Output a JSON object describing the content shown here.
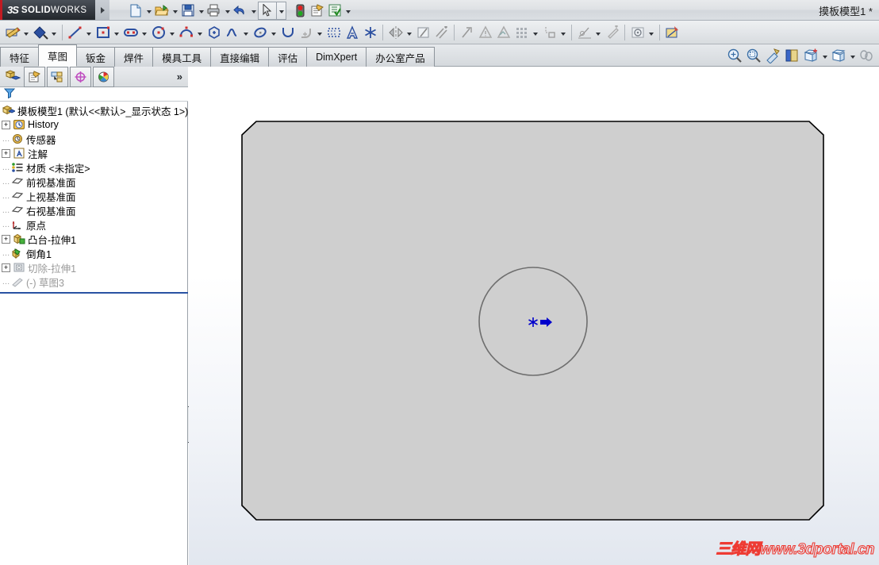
{
  "app": {
    "brand_ds": "3S",
    "brand_name_bold": "SOLID",
    "brand_name_light": "WORKS",
    "document_title": "摸板模型1 *"
  },
  "standard_toolbar": {
    "items": [
      {
        "name": "new-document-button",
        "icon": "new-doc-icon",
        "caret": true
      },
      {
        "name": "open-document-button",
        "icon": "open-folder-icon",
        "caret": true
      },
      {
        "name": "save-button",
        "icon": "save-disk-icon",
        "caret": true
      },
      {
        "name": "print-button",
        "icon": "printer-icon",
        "caret": true
      },
      {
        "name": "undo-button",
        "icon": "undo-arrow-icon",
        "caret": true
      },
      {
        "name": "select-button",
        "icon": "cursor-arrow-icon",
        "caret": true,
        "selected": true
      },
      {
        "name": "rebuild-button",
        "icon": "traffic-light-icon",
        "caret": false
      },
      {
        "name": "file-properties-button",
        "icon": "document-properties-icon",
        "caret": false
      },
      {
        "name": "options-button",
        "icon": "options-checklist-icon",
        "caret": true
      }
    ]
  },
  "sketch_toolbar": {
    "items": [
      {
        "name": "sketch-button",
        "icon": "sketch-pencil-icon",
        "caret": true
      },
      {
        "name": "smart-dimension-button",
        "icon": "smart-dimension-icon",
        "caret": true
      },
      {
        "name": "line-button",
        "icon": "line-icon",
        "caret": true
      },
      {
        "name": "rectangle-button",
        "icon": "rectangle-icon",
        "caret": true
      },
      {
        "name": "slot-button",
        "icon": "slot-icon",
        "caret": true
      },
      {
        "name": "circle-button",
        "icon": "circle-icon",
        "caret": true
      },
      {
        "name": "arc-button",
        "icon": "arc-icon",
        "caret": true
      },
      {
        "name": "polygon-button",
        "icon": "polygon-icon",
        "caret": false
      },
      {
        "name": "spline-button",
        "icon": "spline-icon",
        "caret": true
      },
      {
        "name": "ellipse-button",
        "icon": "ellipse-icon",
        "caret": true
      },
      {
        "name": "parabola-button",
        "icon": "parabola-icon",
        "caret": false
      },
      {
        "name": "fillet-button",
        "icon": "sketch-fillet-icon",
        "caret": true
      },
      {
        "name": "trim-button",
        "icon": "trim-entities-icon",
        "caret": false
      },
      {
        "name": "text-button",
        "icon": "sketch-text-icon",
        "caret": false
      },
      {
        "name": "point-button",
        "icon": "sketch-point-icon",
        "caret": false
      },
      {
        "name": "mirror-button",
        "icon": "mirror-entities-icon",
        "caret": true
      },
      {
        "name": "offset-button",
        "icon": "offset-entities-icon",
        "caret": true
      },
      {
        "name": "convert-entities-button",
        "icon": "convert-entities-icon",
        "caret": false
      },
      {
        "name": "display-delete-relations-button",
        "icon": "relations-icon",
        "caret": false
      },
      {
        "name": "repair-sketch-button",
        "icon": "repair-sketch-icon",
        "caret": false
      },
      {
        "name": "linear-pattern-button",
        "icon": "linear-pattern-icon",
        "caret": true
      },
      {
        "name": "move-entities-button",
        "icon": "move-entities-icon",
        "caret": true
      },
      {
        "name": "quick-snaps-button",
        "icon": "quick-snaps-icon",
        "caret": true
      },
      {
        "name": "rapid-sketch-button",
        "icon": "rapid-sketch-icon",
        "caret": false
      },
      {
        "name": "instant3d-button",
        "icon": "instant3d-icon",
        "caret": true
      },
      {
        "name": "shaded-sketch-contours-button",
        "icon": "shaded-contours-icon",
        "caret": false
      }
    ]
  },
  "command_tabs": {
    "items": [
      {
        "label": "特征",
        "active": false
      },
      {
        "label": "草图",
        "active": true
      },
      {
        "label": "钣金",
        "active": false
      },
      {
        "label": "焊件",
        "active": false
      },
      {
        "label": "模具工具",
        "active": false
      },
      {
        "label": "直接编辑",
        "active": false
      },
      {
        "label": "评估",
        "active": false
      },
      {
        "label": "DimXpert",
        "active": false
      },
      {
        "label": "办公室产品",
        "active": false
      }
    ]
  },
  "view_toolbar": {
    "items": [
      {
        "name": "zoom-to-fit-button",
        "icon": "zoom-fit-icon",
        "caret": false
      },
      {
        "name": "zoom-to-area-button",
        "icon": "zoom-area-icon",
        "caret": false
      },
      {
        "name": "previous-view-button",
        "icon": "previous-view-icon",
        "caret": false
      },
      {
        "name": "section-view-button",
        "icon": "section-view-icon",
        "caret": false
      },
      {
        "name": "view-orientation-button",
        "icon": "view-orientation-icon",
        "caret": true
      },
      {
        "name": "display-style-button",
        "icon": "display-style-icon",
        "caret": true
      },
      {
        "name": "hide-show-items-button",
        "icon": "hide-show-icon",
        "caret": false
      }
    ]
  },
  "feature_manager": {
    "panel_tabs": [
      {
        "name": "feature-manager-tab",
        "icon": "feature-tree-icon",
        "selected": false
      },
      {
        "name": "property-manager-tab",
        "icon": "property-manager-icon",
        "selected": true
      },
      {
        "name": "configuration-manager-tab",
        "icon": "configuration-manager-icon",
        "selected": true
      },
      {
        "name": "dimxpert-manager-tab",
        "icon": "dimxpert-manager-icon",
        "selected": true
      },
      {
        "name": "display-manager-tab",
        "icon": "display-manager-icon",
        "selected": true
      }
    ],
    "expand_chevron": "»",
    "filter_placeholder": "",
    "tree": [
      {
        "label": "摸板模型1  (默认<<默认>_显示状态 1>)",
        "icon": "part-icon",
        "expander": "none",
        "indent": 0,
        "dim": false
      },
      {
        "label": "History",
        "icon": "history-icon",
        "expander": "plus",
        "indent": 1,
        "dim": false
      },
      {
        "label": "传感器",
        "icon": "sensor-icon",
        "expander": "none",
        "indent": 1,
        "dim": false
      },
      {
        "label": "注解",
        "icon": "annotations-icon",
        "expander": "plus",
        "indent": 1,
        "dim": false
      },
      {
        "label": "材质 <未指定>",
        "icon": "material-icon",
        "expander": "none",
        "indent": 1,
        "dim": false
      },
      {
        "label": "前视基准面",
        "icon": "plane-icon",
        "expander": "none",
        "indent": 1,
        "dim": false
      },
      {
        "label": "上视基准面",
        "icon": "plane-icon",
        "expander": "none",
        "indent": 1,
        "dim": false
      },
      {
        "label": "右视基准面",
        "icon": "plane-icon",
        "expander": "none",
        "indent": 1,
        "dim": false
      },
      {
        "label": "原点",
        "icon": "origin-icon",
        "expander": "none",
        "indent": 1,
        "dim": false
      },
      {
        "label": "凸台-拉伸1",
        "icon": "extrude-boss-icon",
        "expander": "plus",
        "indent": 1,
        "dim": false
      },
      {
        "label": "倒角1",
        "icon": "chamfer-icon",
        "expander": "none",
        "indent": 1,
        "dim": false
      },
      {
        "label": "切除-拉伸1",
        "icon": "extrude-cut-icon",
        "expander": "plus",
        "indent": 1,
        "dim": true
      },
      {
        "label": "(-) 草图3",
        "icon": "sketch-icon",
        "expander": "none",
        "indent": 1,
        "dim": true
      }
    ]
  },
  "graphics_area": {
    "watermark": "三维网www.3dportal.cn",
    "model": {
      "name": "chamfered-plate",
      "face_color": "#cfcfcf",
      "edge_color": "#000000",
      "circle_color": "#6e6e6e",
      "sketch_point_color": "#0000ff",
      "cursor_color": "#0000cc"
    }
  },
  "colors": {
    "accent_red": "#c11b22",
    "title_bar_dark": "#23272c",
    "selection_blue": "#2952a3",
    "watermark_red": "#ee3b33"
  }
}
